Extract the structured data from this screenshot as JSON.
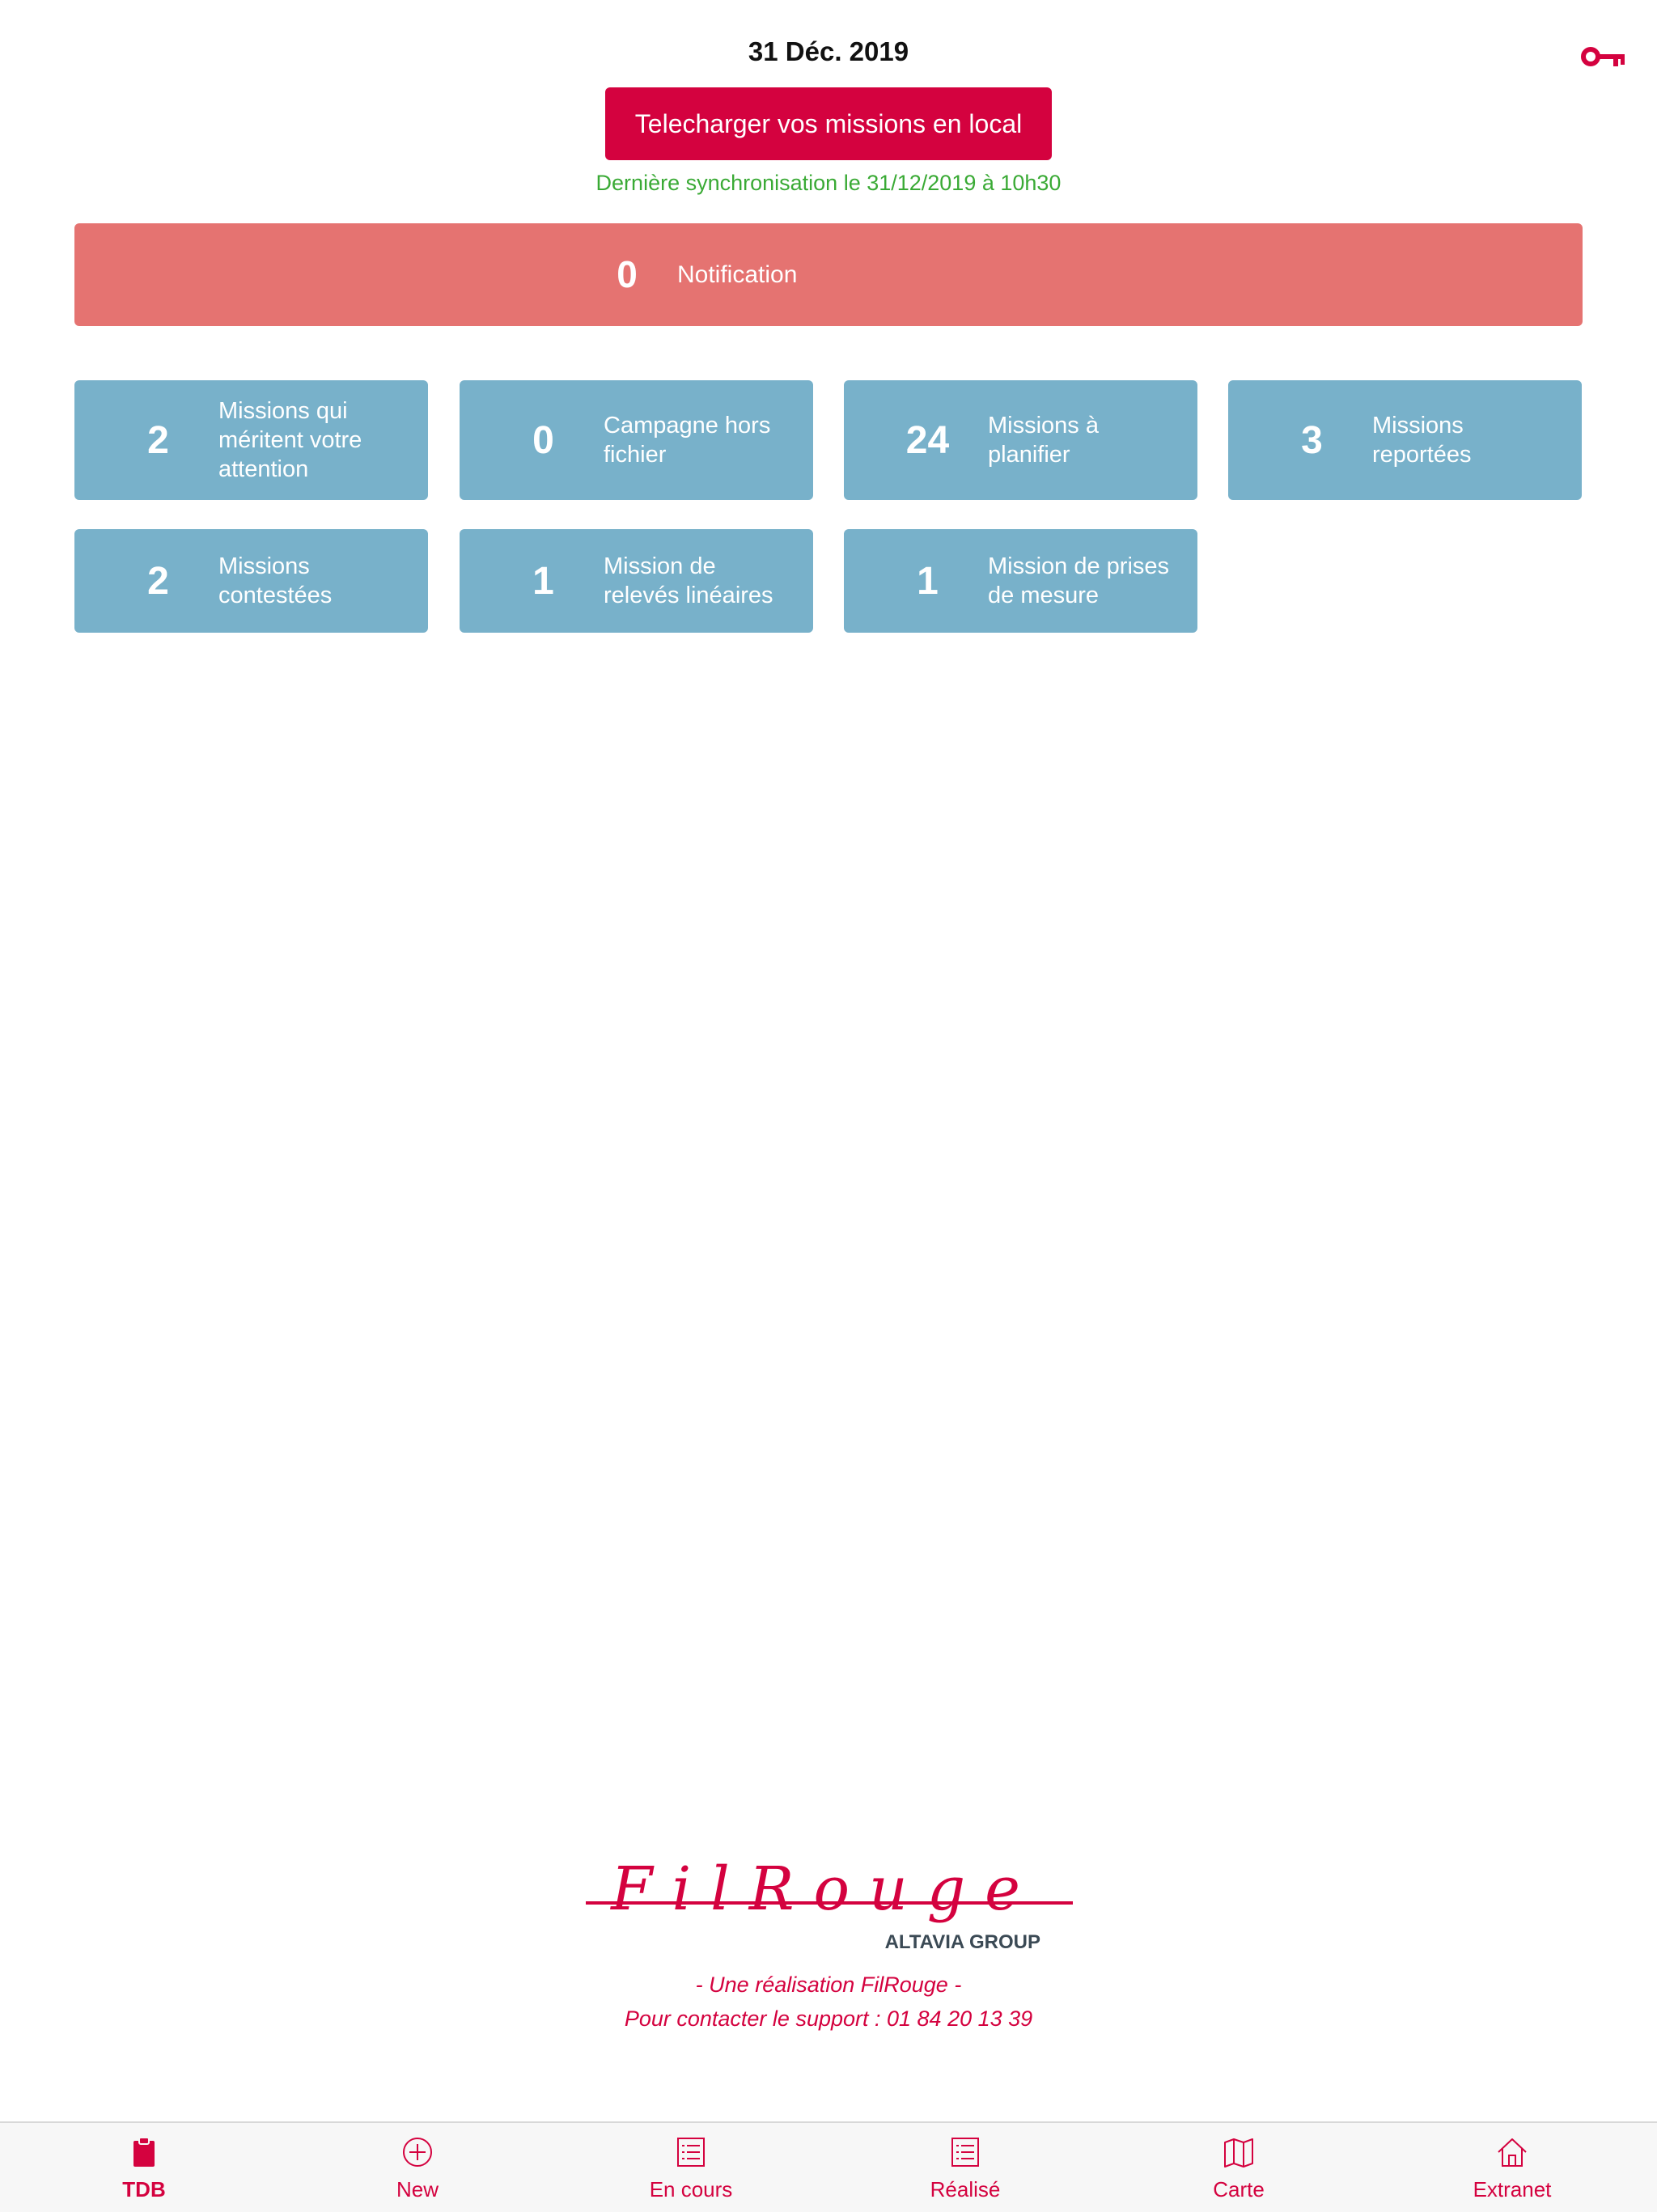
{
  "header": {
    "date": "31 Déc. 2019",
    "key_icon": "key-icon",
    "download_button": "Telecharger vos missions en local",
    "last_sync": "Dernière synchronisation le 31/12/2019 à 10h30"
  },
  "notification": {
    "count": "0",
    "label": "Notification"
  },
  "tiles": [
    {
      "count": "2",
      "label": "Missions qui méritent votre attention"
    },
    {
      "count": "0",
      "label": "Campagne hors fichier"
    },
    {
      "count": "24",
      "label": "Missions à planifier"
    },
    {
      "count": "3",
      "label": "Missions reportées"
    },
    {
      "count": "2",
      "label": "Missions contestées"
    },
    {
      "count": "1",
      "label": "Mission de relevés linéaires"
    },
    {
      "count": "1",
      "label": "Mission de prises de mesure"
    }
  ],
  "footer": {
    "logo_text": "FilRouge",
    "logo_group": "ALTAVIA GROUP",
    "credit": "- Une réalisation FilRouge -",
    "support": "Pour contacter le support : 01 84 20 13 39"
  },
  "tabs": [
    {
      "label": "TDB",
      "icon": "clipboard-icon",
      "active": true
    },
    {
      "label": "New",
      "icon": "plus-circle-icon",
      "active": false
    },
    {
      "label": "En cours",
      "icon": "list-icon",
      "active": false
    },
    {
      "label": "Réalisé",
      "icon": "list-icon",
      "active": false
    },
    {
      "label": "Carte",
      "icon": "map-icon",
      "active": false
    },
    {
      "label": "Extranet",
      "icon": "home-icon",
      "active": false
    }
  ],
  "colors": {
    "accent": "#d4023f",
    "notification_bg": "#e57371",
    "tile_bg": "#78b1ca",
    "sync_text": "#3aaa35"
  }
}
